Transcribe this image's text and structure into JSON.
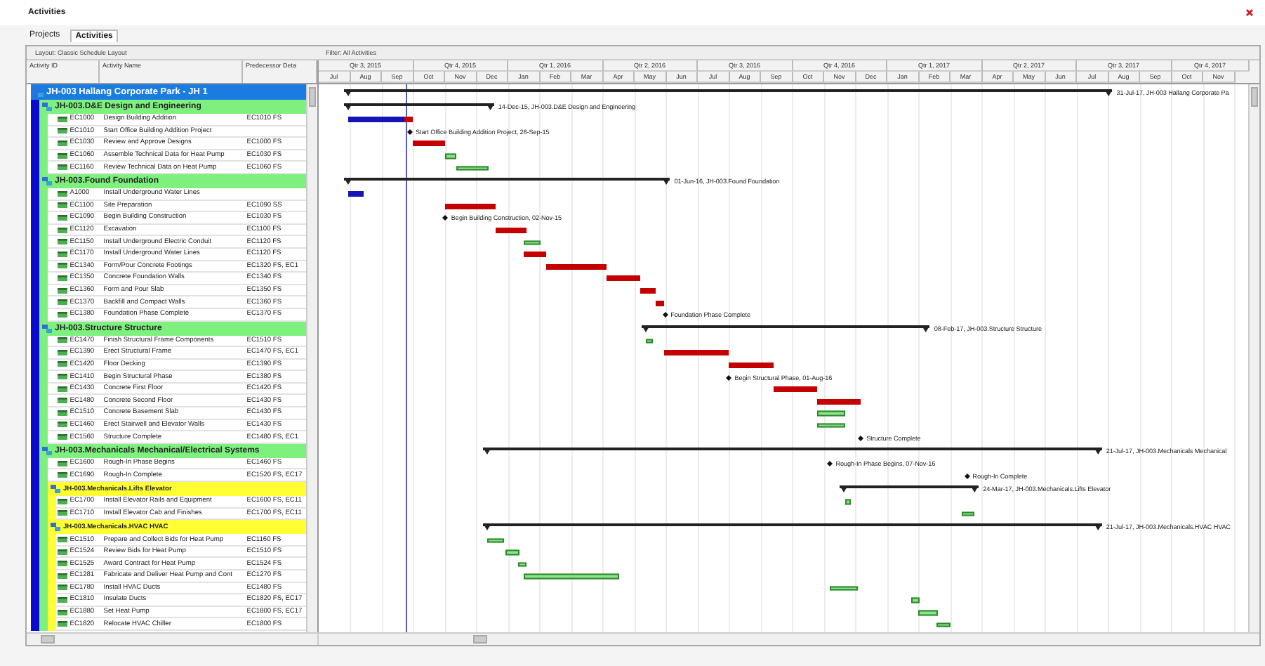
{
  "window": {
    "title": "Activities"
  },
  "tabs": [
    {
      "label": "Projects",
      "selected": false
    },
    {
      "label": "Activities",
      "selected": true
    }
  ],
  "layout_label": "Layout: Classic Schedule Layout",
  "filter_label": "Filter: All Activities",
  "columns": [
    "Activity ID",
    "Activity Name",
    "Predecessor Deta"
  ],
  "timescale": {
    "quarters": [
      "Qtr 3, 2015",
      "Qtr 4, 2015",
      "Qtr 1, 2016",
      "Qtr 2, 2016",
      "Qtr 3, 2016",
      "Qtr 4, 2016",
      "Qtr 1, 2017",
      "Qtr 2, 2017",
      "Qtr 3, 2017",
      "Qtr 4, 2017"
    ],
    "months": [
      "Jul",
      "Aug",
      "Sep",
      "Oct",
      "Nov",
      "Dec",
      "Jan",
      "Feb",
      "Mar",
      "Apr",
      "May",
      "Jun",
      "Jul",
      "Aug",
      "Sep",
      "Oct",
      "Nov",
      "Dec",
      "Jan",
      "Feb",
      "Mar",
      "Apr",
      "May",
      "Jun",
      "Jul",
      "Aug",
      "Sep",
      "Oct",
      "Nov"
    ]
  },
  "project": {
    "kind": "project",
    "name": "JH-003 Hallang Corporate Park - JH 1",
    "label": "31-Jul-17, JH-003 Hallang Corporate Pa",
    "children": [
      {
        "kind": "wbs",
        "name": "JH-003.D&E Design and Engineering",
        "label": "14-Dec-15, JH-003.D&E Design and Engineering",
        "children": [
          {
            "kind": "task",
            "id": "EC1000",
            "name": "Design Building Addition",
            "predecessors": "EC1010 FS",
            "bars": [
              {
                "kind": "actual"
              },
              {
                "kind": "critical"
              }
            ]
          },
          {
            "kind": "milestone",
            "id": "EC1010",
            "name": "Start Office Building Addition Project",
            "label": "Start Office Building Addition Project, 28-Sep-15"
          },
          {
            "kind": "task",
            "id": "EC1030",
            "name": "Review and Approve Designs",
            "predecessors": "EC1000 FS",
            "bars": [
              {
                "kind": "critical"
              }
            ]
          },
          {
            "kind": "task",
            "id": "EC1060",
            "name": "Assemble Technical Data for Heat Pump",
            "predecessors": "EC1030 FS",
            "bars": [
              {
                "kind": "remaining"
              }
            ]
          },
          {
            "kind": "task",
            "id": "EC1160",
            "name": "Review Technical Data on Heat Pump",
            "predecessors": "EC1060 FS",
            "bars": [
              {
                "kind": "remaining"
              }
            ]
          }
        ]
      },
      {
        "kind": "wbs",
        "name": "JH-003.Found Foundation",
        "label": "01-Jun-16, JH-003.Found Foundation",
        "children": [
          {
            "kind": "task",
            "id": "A1000",
            "name": "Install Underground Water Lines",
            "bars": [
              {
                "kind": "actual"
              }
            ]
          },
          {
            "kind": "task",
            "id": "EC1100",
            "name": "Site Preparation",
            "predecessors": "EC1090 SS",
            "bars": [
              {
                "kind": "critical"
              }
            ]
          },
          {
            "kind": "milestone",
            "id": "EC1090",
            "name": "Begin Building Construction",
            "predecessors": "EC1030 FS",
            "label": "Begin Building Construction, 02-Nov-15"
          },
          {
            "kind": "task",
            "id": "EC1120",
            "name": "Excavation",
            "predecessors": "EC1100 FS",
            "bars": [
              {
                "kind": "critical"
              }
            ]
          },
          {
            "kind": "task",
            "id": "EC1150",
            "name": "Install Underground Electric Conduit",
            "predecessors": "EC1120 FS",
            "bars": [
              {
                "kind": "remaining"
              }
            ]
          },
          {
            "kind": "task",
            "id": "EC1170",
            "name": "Install Underground Water Lines",
            "predecessors": "EC1120 FS",
            "bars": [
              {
                "kind": "critical"
              }
            ]
          },
          {
            "kind": "task",
            "id": "EC1340",
            "name": "Form/Pour Concrete Footings",
            "predecessors": "EC1320 FS, EC1",
            "bars": [
              {
                "kind": "critical"
              }
            ]
          },
          {
            "kind": "task",
            "id": "EC1350",
            "name": "Concrete Foundation Walls",
            "predecessors": "EC1340 FS",
            "bars": [
              {
                "kind": "critical"
              }
            ]
          },
          {
            "kind": "task",
            "id": "EC1360",
            "name": "Form and Pour Slab",
            "predecessors": "EC1350 FS",
            "bars": [
              {
                "kind": "critical"
              }
            ]
          },
          {
            "kind": "task",
            "id": "EC1370",
            "name": "Backfill and Compact Walls",
            "predecessors": "EC1360 FS",
            "bars": [
              {
                "kind": "critical"
              }
            ]
          },
          {
            "kind": "milestone",
            "id": "EC1380",
            "name": "Foundation Phase Complete",
            "predecessors": "EC1370 FS",
            "label": "Foundation Phase Complete"
          }
        ]
      },
      {
        "kind": "wbs",
        "name": "JH-003.Structure Structure",
        "label": "08-Feb-17, JH-003.Structure Structure",
        "children": [
          {
            "kind": "task",
            "id": "EC1470",
            "name": "Finish Structural Frame Components",
            "predecessors": "EC1510 FS",
            "bars": [
              {
                "kind": "remaining"
              }
            ]
          },
          {
            "kind": "task",
            "id": "EC1390",
            "name": "Erect Structural Frame",
            "predecessors": "EC1470 FS, EC1",
            "bars": [
              {
                "kind": "critical"
              }
            ]
          },
          {
            "kind": "task",
            "id": "EC1420",
            "name": "Floor Decking",
            "predecessors": "EC1390 FS",
            "bars": [
              {
                "kind": "critical"
              }
            ]
          },
          {
            "kind": "milestone",
            "id": "EC1410",
            "name": "Begin Structural Phase",
            "predecessors": "EC1380 FS",
            "label": "Begin Structural Phase, 01-Aug-16"
          },
          {
            "kind": "task",
            "id": "EC1430",
            "name": "Concrete First Floor",
            "predecessors": "EC1420 FS",
            "bars": [
              {
                "kind": "critical"
              }
            ]
          },
          {
            "kind": "task",
            "id": "EC1480",
            "name": "Concrete Second Floor",
            "predecessors": "EC1430 FS",
            "bars": [
              {
                "kind": "critical"
              }
            ]
          },
          {
            "kind": "task",
            "id": "EC1510",
            "name": "Concrete Basement Slab",
            "predecessors": "EC1430 FS",
            "bars": [
              {
                "kind": "remaining"
              }
            ]
          },
          {
            "kind": "task",
            "id": "EC1460",
            "name": "Erect Stairwell and Elevator Walls",
            "predecessors": "EC1430 FS",
            "bars": [
              {
                "kind": "remaining"
              }
            ]
          },
          {
            "kind": "milestone",
            "id": "EC1560",
            "name": "Structure Complete",
            "predecessors": "EC1480 FS, EC1",
            "label": "Structure Complete"
          }
        ]
      },
      {
        "kind": "wbs",
        "name": "JH-003.Mechanicals Mechanical/Electrical Systems",
        "label": "21-Jul-17, JH-003.Mechanicals Mechanical",
        "children": [
          {
            "kind": "milestone",
            "id": "EC1600",
            "name": "Rough-In Phase Begins",
            "predecessors": "EC1460 FS",
            "label": "Rough-In Phase Begins, 07-Nov-16"
          },
          {
            "kind": "milestone",
            "id": "EC1690",
            "name": "Rough-In Complete",
            "predecessors": "EC1520 FS, EC17",
            "label": "Rough-In Complete"
          },
          {
            "kind": "wbs",
            "name": "JH-003.Mechanicals.Lifts Elevator",
            "label": "24-Mar-17, JH-003.Mechanicals.Lifts Elevator",
            "children": [
              {
                "kind": "task",
                "id": "EC1700",
                "name": "Install Elevator Rails and Equipment",
                "predecessors": "EC1600 FS, EC11",
                "bars": [
                  {
                    "kind": "remaining"
                  }
                ]
              },
              {
                "kind": "task",
                "id": "EC1710",
                "name": "Install Elevator Cab and Finishes",
                "predecessors": "EC1700 FS, EC11",
                "bars": [
                  {
                    "kind": "remaining"
                  }
                ]
              }
            ]
          },
          {
            "kind": "wbs",
            "name": "JH-003.Mechanicals.HVAC HVAC",
            "label": "21-Jul-17, JH-003.Mechanicals.HVAC HVAC",
            "children": [
              {
                "kind": "task",
                "id": "EC1510",
                "name": "Prepare and Collect Bids for Heat Pump",
                "predecessors": "EC1160 FS",
                "bars": [
                  {
                    "kind": "remaining"
                  }
                ]
              },
              {
                "kind": "task",
                "id": "EC1524",
                "name": "Review Bids for Heat Pump",
                "predecessors": "EC1510 FS",
                "bars": [
                  {
                    "kind": "remaining"
                  }
                ]
              },
              {
                "kind": "task",
                "id": "EC1525",
                "name": "Award Contract for Heat Pump",
                "predecessors": "EC1524 FS",
                "bars": [
                  {
                    "kind": "remaining"
                  }
                ]
              },
              {
                "kind": "task",
                "id": "EC1281",
                "name": "Fabricate and Deliver Heat Pump and Cont",
                "predecessors": "EC1270 FS",
                "bars": [
                  {
                    "kind": "remaining"
                  }
                ]
              },
              {
                "kind": "task",
                "id": "EC1780",
                "name": "Install HVAC Ducts",
                "predecessors": "EC1480 FS",
                "bars": [
                  {
                    "kind": "remaining"
                  }
                ]
              },
              {
                "kind": "task",
                "id": "EC1810",
                "name": "Insulate Ducts",
                "predecessors": "EC1820 FS, EC17",
                "bars": [
                  {
                    "kind": "remaining"
                  }
                ]
              },
              {
                "kind": "task",
                "id": "EC1880",
                "name": "Set Heat Pump",
                "predecessors": "EC1800 FS, EC17",
                "bars": [
                  {
                    "kind": "remaining"
                  }
                ]
              },
              {
                "kind": "task",
                "id": "EC1820",
                "name": "Relocate HVAC Chiller",
                "predecessors": "EC1800 FS",
                "bars": [
                  {
                    "kind": "remaining"
                  }
                ]
              }
            ]
          }
        ]
      }
    ]
  }
}
